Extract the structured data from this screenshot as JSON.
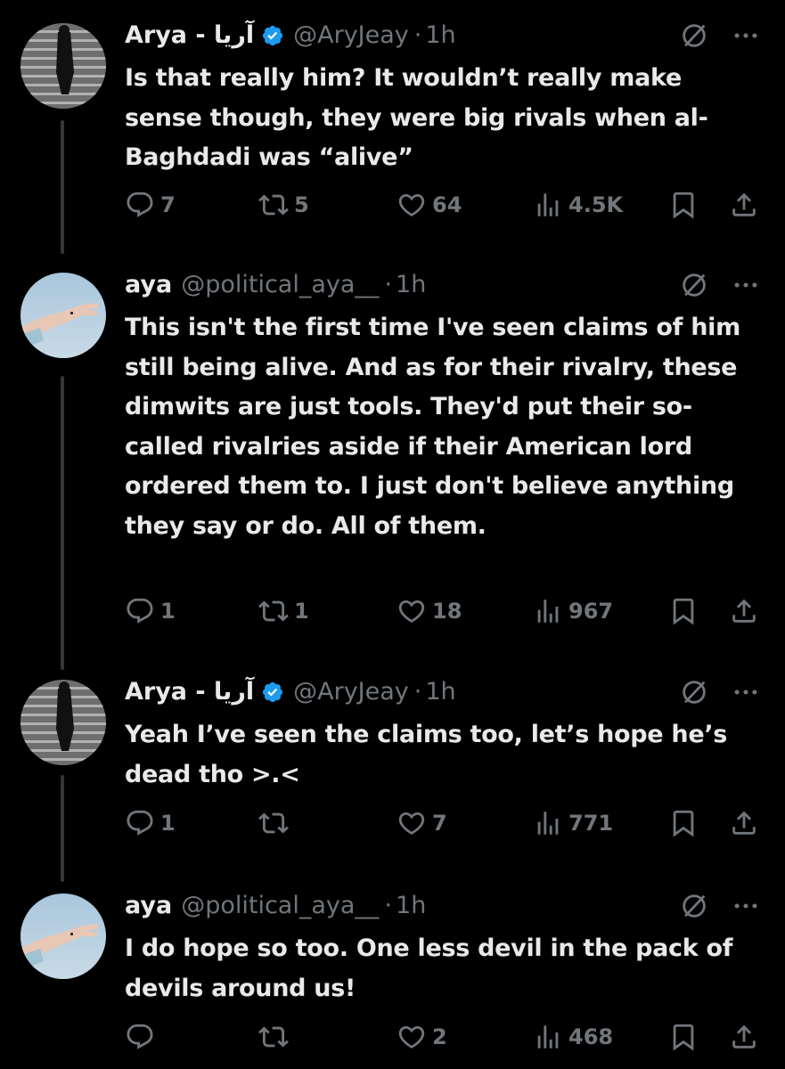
{
  "tweets": [
    {
      "name": "Arya - آریا",
      "handle": "@AryJeay",
      "separator": "·",
      "time": "1h",
      "verified": true,
      "text": "Is that really him? It wouldn’t really make sense though, they were big rivals when al-Baghdadi was “alive”",
      "replies": "7",
      "reposts": "5",
      "likes": "64",
      "views": "4.5K"
    },
    {
      "name": "aya",
      "handle": "@political_aya__",
      "separator": "·",
      "time": "1h",
      "verified": false,
      "text": "This isn't the first time I've seen claims of him still being alive. And as for their rivalry, these dimwits are just tools. They'd put their so-called rivalries aside if their American lord ordered them to. I just don't believe anything they say or do. All of them.",
      "replies": "1",
      "reposts": "1",
      "likes": "18",
      "views": "967"
    },
    {
      "name": "Arya - آریا",
      "handle": "@AryJeay",
      "separator": "·",
      "time": "1h",
      "verified": true,
      "text": "Yeah I’ve seen the claims too, let’s hope he’s dead tho >.<",
      "replies": "1",
      "reposts": "",
      "likes": "7",
      "views": "771"
    },
    {
      "name": "aya",
      "handle": "@political_aya__",
      "separator": "·",
      "time": "1h",
      "verified": false,
      "text": "I do hope so too. One less devil in the pack of devils around us!",
      "replies": "",
      "reposts": "",
      "likes": "2",
      "views": "468"
    }
  ],
  "icons": {
    "reply": "reply-icon",
    "repost": "repost-icon",
    "like": "heart-icon",
    "views": "views-icon",
    "bookmark": "bookmark-icon",
    "share": "share-icon",
    "grok": "grok-icon",
    "more": "more-icon",
    "verified": "verified-badge-icon"
  },
  "colors": {
    "background": "#000000",
    "text": "#e7e9ea",
    "secondary": "#71767b",
    "verified": "#1d9bf0",
    "thread_line": "#333639"
  }
}
